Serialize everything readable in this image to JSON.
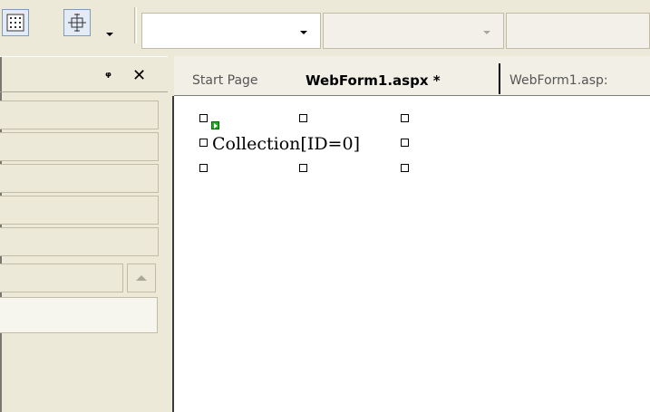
{
  "toolbar": {
    "buttons": [
      {
        "icon": "grid-icon"
      },
      {
        "icon": "snap-to-grid-icon"
      }
    ],
    "combos": [
      {
        "value": ""
      },
      {
        "value": ""
      },
      {
        "value": ""
      }
    ]
  },
  "panel": {
    "pin_glyph": "ᵠ",
    "close_glyph": "✕"
  },
  "tabs": [
    {
      "label": "Start Page",
      "active": false
    },
    {
      "label": "WebForm1.aspx *",
      "active": true
    },
    {
      "label": "WebForm1.asp:",
      "active": false
    }
  ],
  "designer": {
    "control_text": "Collection[ID=0]"
  },
  "colors": {
    "chrome": "#ece9d8",
    "selected_button": "#e3ebf7",
    "glyph_green": "#22aa22"
  }
}
